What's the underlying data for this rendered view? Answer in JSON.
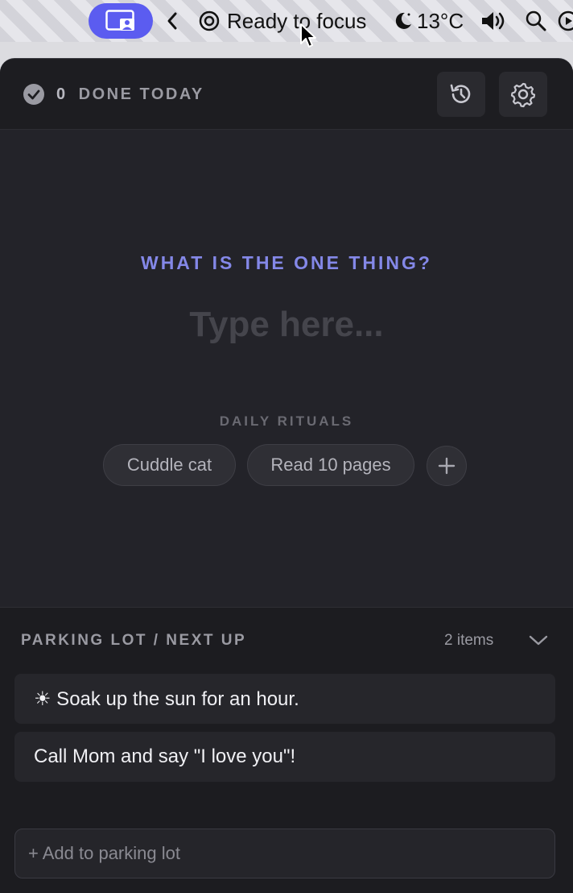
{
  "menubar": {
    "status_text": "Ready to focus",
    "weather_text": "13°C",
    "icons": [
      "screen-share-icon",
      "chevron-left-icon",
      "target-icon",
      "moon-icon",
      "volume-icon",
      "search-icon",
      "play-icon"
    ]
  },
  "header": {
    "done_count": "0",
    "done_label": "DONE TODAY",
    "icons": [
      "check-circle-icon",
      "history-icon",
      "gear-icon"
    ]
  },
  "focus": {
    "question": "WHAT IS THE ONE THING?",
    "input_placeholder": "Type here...",
    "input_value": ""
  },
  "rituals": {
    "label": "DAILY RITUALS",
    "items": [
      "Cuddle cat",
      "Read 10 pages"
    ],
    "add_icon": "plus-icon"
  },
  "parking": {
    "title": "PARKING LOT / NEXT UP",
    "count_text": "2 items",
    "items": [
      "☀ Soak up the sun for an hour.",
      "Call Mom and say \"I love you\"!"
    ],
    "add_placeholder": "+ Add to parking lot"
  },
  "colors": {
    "accent": "#5b5cf0",
    "question": "#8488e8",
    "panel_bg": "#1c1c20",
    "focus_bg": "#232329"
  }
}
